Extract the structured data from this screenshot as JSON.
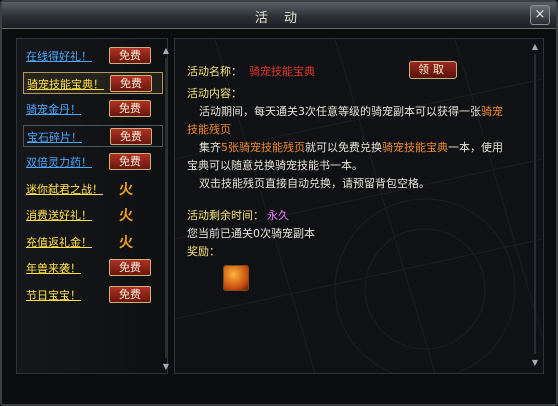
{
  "window": {
    "title": "活 动",
    "close_glyph": "×"
  },
  "sidebar": {
    "items": [
      {
        "label": "在线得好礼！",
        "color": "#4aa8ff",
        "badge": "free"
      },
      {
        "label": "骑宠技能宝典！",
        "color": "#ffe04a",
        "badge": "free",
        "selected": true
      },
      {
        "label": "骑宠金丹！",
        "color": "#4aa8ff",
        "badge": "free"
      },
      {
        "label": "宝石碎片！",
        "color": "#4aa8ff",
        "badge": "free",
        "highlighted": true
      },
      {
        "label": "双倍灵力药！",
        "color": "#4aa8ff",
        "badge": "free"
      },
      {
        "label": "迷你弑君之战！",
        "color": "#ffe04a",
        "badge": "flame"
      },
      {
        "label": "消费送好礼！",
        "color": "#ffe04a",
        "badge": "flame"
      },
      {
        "label": "充值返礼金！",
        "color": "#ffe04a",
        "badge": "flame"
      },
      {
        "label": "年兽来袭！",
        "color": "#ffe04a",
        "badge": "free"
      },
      {
        "label": "节日宝宝！",
        "color": "#ffe04a",
        "badge": "free"
      }
    ],
    "free_label": "免费",
    "flame_glyph": "火"
  },
  "detail": {
    "name_label": "活动名称：",
    "name_value": "骑宠技能宝典",
    "claim_label": "领取",
    "content_label": "活动内容：",
    "para1_a": "活动期间，每天通关3次任意等级的骑宠副本可以获得一张",
    "para1_b": "骑宠",
    "para1_c": "技能残页",
    "para2_a": "集齐",
    "para2_b": "5张骑宠技能残页",
    "para2_c": "就可以免费兑换",
    "para2_d": "骑宠技能宝典",
    "para2_e": "一本，使用",
    "para2_f": "宝典可以随意兑换骑宠技能书一本。",
    "para3": "双击技能残页直接自动兑换，请预留背包空格。",
    "remain_label": "活动剩余时间：",
    "remain_value": "永久",
    "progress_text": "您当前已通关0次骑宠副本",
    "reward_label": "奖励："
  },
  "colors": {
    "accent_gold": "#c7b27a",
    "button_red": "#9b2a1f"
  }
}
